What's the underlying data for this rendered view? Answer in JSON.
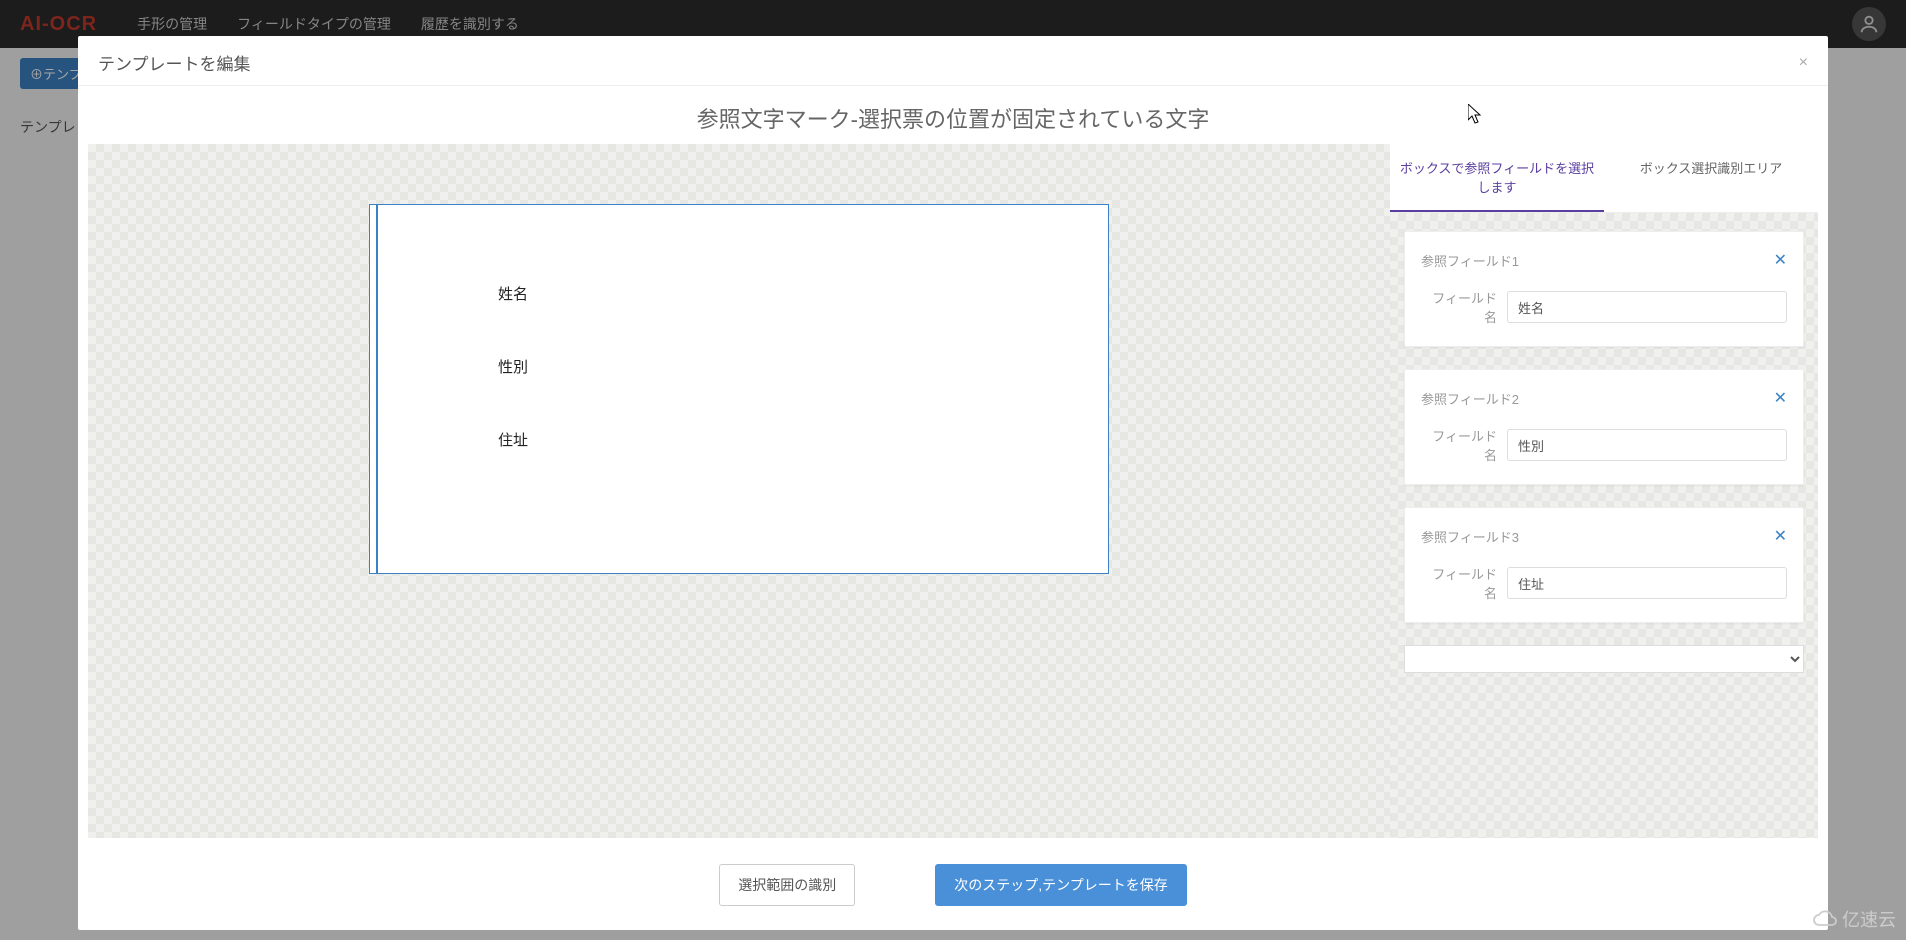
{
  "brand": "AI-OCR",
  "nav": {
    "items": [
      "手形の管理",
      "フィールドタイプの管理",
      "履歴を識別する"
    ]
  },
  "page": {
    "add_button": "⊕テンプレ",
    "side_label": "テンプレ"
  },
  "modal": {
    "title": "テンプレートを編集",
    "subtitle": "参照文字マーク-選択票の位置が固定されている文字",
    "close": "×"
  },
  "document": {
    "fields": [
      "姓名",
      "性別",
      "住址"
    ]
  },
  "tabs": {
    "active": "ボックスで参照フィールドを選択します",
    "inactive": "ボックス選択識別エリア"
  },
  "fieldname_label": "フィールド名",
  "cards": [
    {
      "title": "参照フィールド1",
      "value": "姓名"
    },
    {
      "title": "参照フィールド2",
      "value": "性別"
    },
    {
      "title": "参照フィールド3",
      "value": "住址"
    }
  ],
  "card_close": "✕",
  "footer": {
    "recognize": "選択範囲の識別",
    "next": "次のステップ,テンプレートを保存"
  },
  "watermark": "亿速云"
}
